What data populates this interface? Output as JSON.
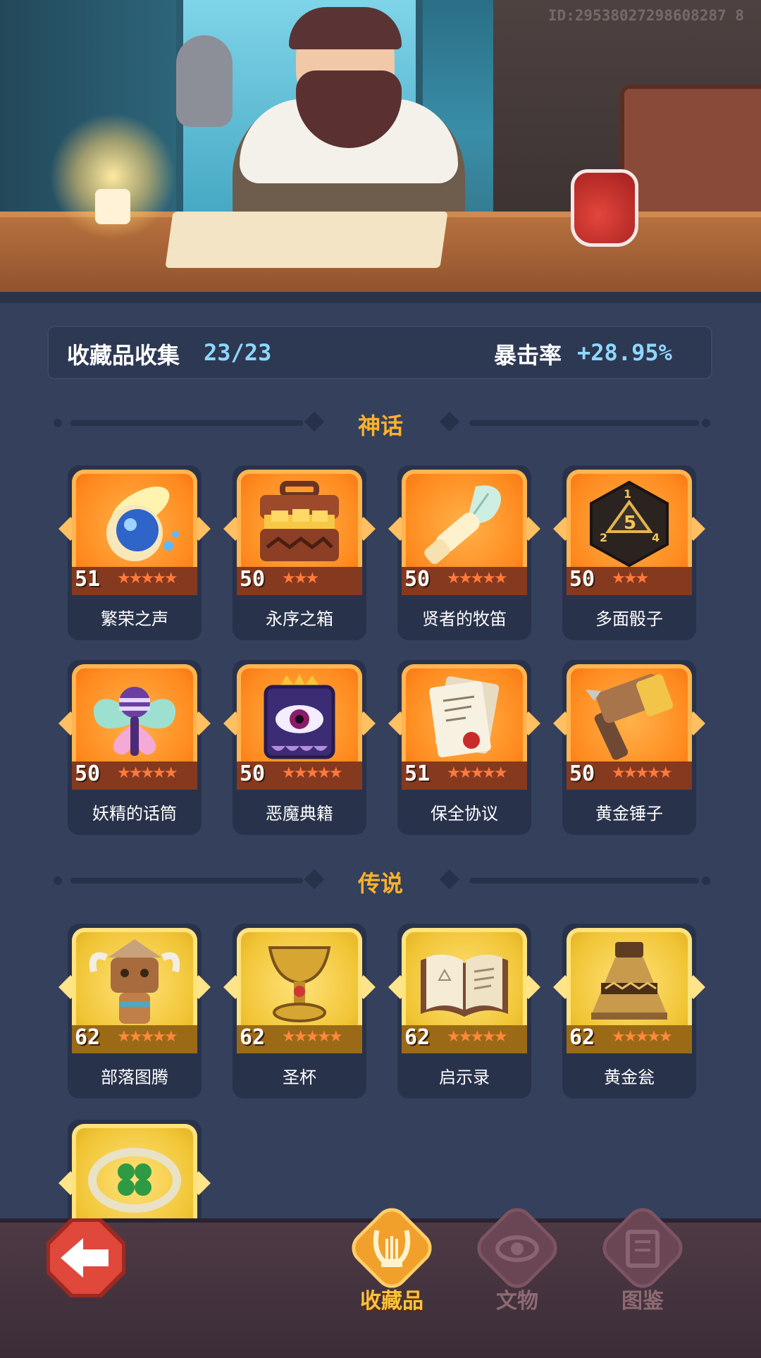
{
  "banner": {
    "id_text": "ID:29538027298608287 8"
  },
  "stats": {
    "collection_label": "收藏品收集",
    "collection_value": "23/23",
    "crit_label": "暴击率",
    "crit_value": "+28.95%"
  },
  "sections": {
    "mythic_title": "神话",
    "legendary_title": "传说"
  },
  "mythic_items": [
    {
      "name": "繁荣之声",
      "level": "51",
      "stars": "★★★★★",
      "icon": "bubble-feather-icon"
    },
    {
      "name": "永序之箱",
      "level": "50",
      "stars": "★★★",
      "icon": "gold-chest-icon"
    },
    {
      "name": "贤者的牧笛",
      "level": "50",
      "stars": "★★★★★",
      "icon": "feather-flute-icon"
    },
    {
      "name": "多面骰子",
      "level": "50",
      "stars": "★★★",
      "icon": "dice-icon"
    },
    {
      "name": "妖精的话筒",
      "level": "50",
      "stars": "★★★★★",
      "icon": "fairy-microphone-icon"
    },
    {
      "name": "恶魔典籍",
      "level": "50",
      "stars": "★★★★★",
      "icon": "demon-book-icon"
    },
    {
      "name": "保全协议",
      "level": "51",
      "stars": "★★★★★",
      "icon": "scroll-contract-icon"
    },
    {
      "name": "黄金锤子",
      "level": "50",
      "stars": "★★★★★",
      "icon": "golden-hammer-icon"
    }
  ],
  "legendary_items": [
    {
      "name": "部落图腾",
      "level": "62",
      "stars": "★★★★★",
      "icon": "tribal-totem-icon"
    },
    {
      "name": "圣杯",
      "level": "62",
      "stars": "★★★★★",
      "icon": "grail-icon"
    },
    {
      "name": "启示录",
      "level": "62",
      "stars": "★★★★★",
      "icon": "open-book-icon"
    },
    {
      "name": "黄金瓮",
      "level": "62",
      "stars": "★★★★★",
      "icon": "golden-urn-icon"
    },
    {
      "name": "",
      "level": "",
      "stars": "",
      "icon": "clover-ring-icon"
    }
  ],
  "bottom_nav": {
    "tabs": [
      {
        "label": "收藏品",
        "icon": "lyre-icon",
        "active": true
      },
      {
        "label": "文物",
        "icon": "eye-icon",
        "active": false
      },
      {
        "label": "图鉴",
        "icon": "book-icon",
        "active": false
      }
    ],
    "back_icon": "back-arrow-icon"
  },
  "colors": {
    "background": "#34405c",
    "mythic_tile": "#ff8a1e",
    "legendary_tile": "#f0c434",
    "section_title": "#ffb22a",
    "stat_value": "#8ed8ff"
  }
}
